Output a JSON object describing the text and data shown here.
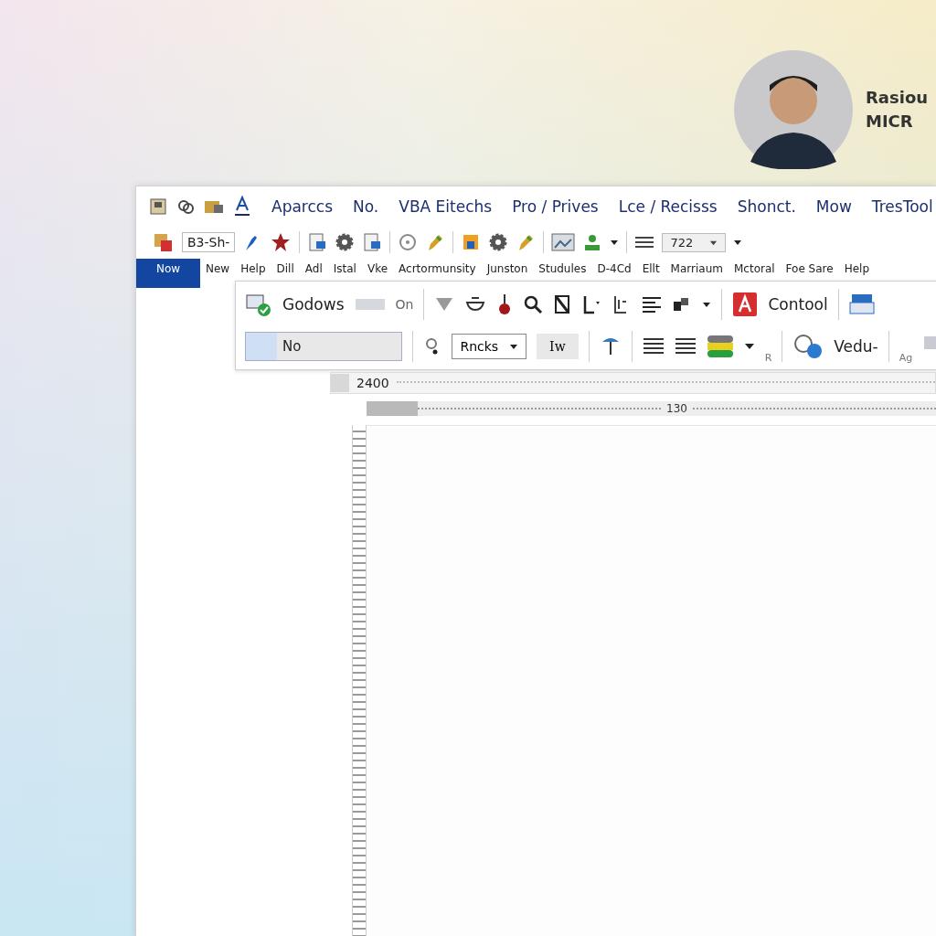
{
  "profile": {
    "name": "Rasiou",
    "subtitle": "MICR"
  },
  "menu": {
    "items": [
      "Aparccs",
      "No.",
      "VBA Eitechs",
      "Pro / Prives",
      "Lce / Recisss",
      "Shonct.",
      "Mow",
      "TresTool"
    ]
  },
  "toolbar": {
    "font_field": "B3-Sh-",
    "zoom_field": "722"
  },
  "tabs": [
    {
      "label": "Now",
      "selected": true
    },
    {
      "label": "New",
      "selected": false
    },
    {
      "label": "Help",
      "selected": false
    },
    {
      "label": "Dill",
      "selected": false
    },
    {
      "label": "Adl",
      "selected": false
    },
    {
      "label": "Istal",
      "selected": false
    },
    {
      "label": "Vke",
      "selected": false
    },
    {
      "label": "Acrtormunsity",
      "selected": false
    },
    {
      "label": "Junston",
      "selected": false
    },
    {
      "label": "Studules",
      "selected": false
    },
    {
      "label": "D-4Cd",
      "selected": false
    },
    {
      "label": "Ellt",
      "selected": false
    },
    {
      "label": "Marriaum",
      "selected": false
    },
    {
      "label": "Mctoral",
      "selected": false
    },
    {
      "label": "Foe Sare",
      "selected": false
    },
    {
      "label": "Help",
      "selected": false
    }
  ],
  "ribbon": {
    "style_label": "Godows",
    "on_dropdown": "On",
    "control_label": "Contool",
    "style_button": "No",
    "rncks_dropdown": "Rncks",
    "iw_field": "Iw",
    "vedu_label": "Vedu-",
    "corner_label_1": "R",
    "corner_label_2": "Ag"
  },
  "ruler": {
    "value": "2400",
    "mark": "130"
  }
}
